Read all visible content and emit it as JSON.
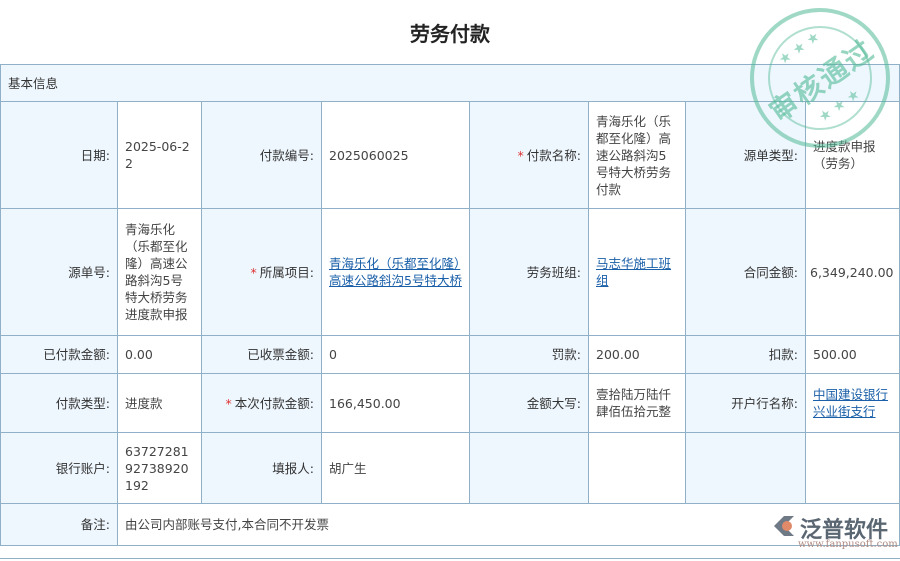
{
  "title": "劳务付款",
  "section": "基本信息",
  "stamp": "审核通过",
  "logo": {
    "name": "泛普软件",
    "url": "www.fanpusoft.com"
  },
  "fields": {
    "date": {
      "label": "日期:",
      "value": "2025-06-22"
    },
    "pay_no": {
      "label": "付款编号:",
      "value": "2025060025"
    },
    "pay_name": {
      "label": "付款名称:",
      "value": "青海乐化（乐都至化隆）高速公路斜沟5号特大桥劳务付款"
    },
    "source_type": {
      "label": "源单类型:",
      "value": "进度款申报（劳务）"
    },
    "source_no": {
      "label": "源单号:",
      "value": "青海乐化（乐都至化隆）高速公路斜沟5号特大桥劳务进度款申报"
    },
    "project": {
      "label": "所属项目:",
      "value": "青海乐化（乐都至化隆）高速公路斜沟5号特大桥"
    },
    "team": {
      "label": "劳务班组:",
      "value": "马志华施工班组"
    },
    "contract_amount": {
      "label": "合同金额:",
      "value": "6,349,240.00"
    },
    "paid_amount": {
      "label": "已付款金额:",
      "value": "0.00"
    },
    "invoiced_amount": {
      "label": "已收票金额:",
      "value": "0"
    },
    "penalty": {
      "label": "罚款:",
      "value": "200.00"
    },
    "deduction": {
      "label": "扣款:",
      "value": "500.00"
    },
    "pay_type": {
      "label": "付款类型:",
      "value": "进度款"
    },
    "this_amount": {
      "label": "本次付款金额:",
      "value": "166,450.00"
    },
    "amount_upper": {
      "label": "金额大写:",
      "value": "壹拾陆万陆仟肆佰伍拾元整"
    },
    "bank_name": {
      "label": "开户行名称:",
      "value": "中国建设银行兴业街支行"
    },
    "bank_account": {
      "label": "银行账户:",
      "value": "6372728192738920192"
    },
    "reporter": {
      "label": "填报人:",
      "value": "胡广生"
    },
    "remark": {
      "label": "备注:",
      "value": "由公司内部账号支付,本合同不开发票"
    }
  },
  "required_mark": "*"
}
